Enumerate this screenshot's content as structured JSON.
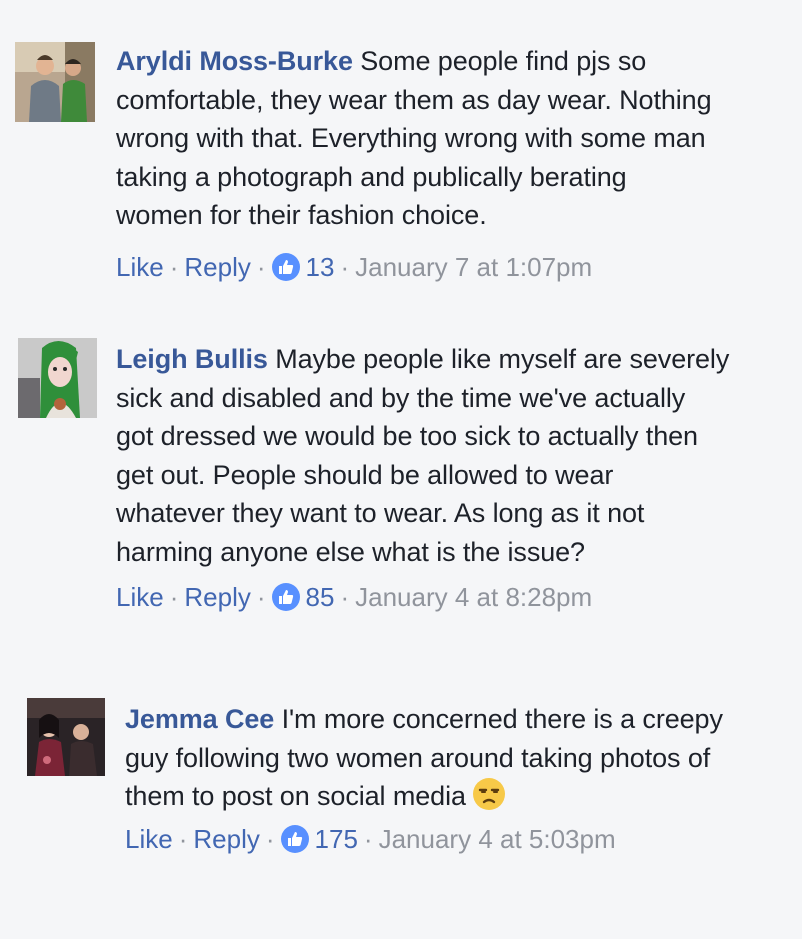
{
  "comments": [
    {
      "author": "Aryldi Moss-Burke",
      "text_lines": [
        " Some people find pjs so",
        "comfortable, they wear them as day wear. Nothing",
        "wrong with that. Everything wrong with some man",
        "taking a photograph and publically berating",
        "women for their fashion choice."
      ],
      "like_label": "Like",
      "reply_label": "Reply",
      "like_count": "13",
      "timestamp": "January 7 at 1:07pm"
    },
    {
      "author": "Leigh Bullis",
      "text_lines": [
        " Maybe people like myself are severely",
        "sick and disabled and by the time we've actually",
        "got dressed we would be too sick to actually then",
        "get out. People should be allowed to wear",
        "whatever they want to wear. As long as it not",
        "harming anyone else what is the issue?"
      ],
      "like_label": "Like",
      "reply_label": "Reply",
      "like_count": "85",
      "timestamp": "January 4 at 8:28pm"
    },
    {
      "author": "Jemma Cee",
      "text_lines": [
        " I'm more concerned there is a creepy",
        "guy following two women around taking photos of",
        "them to post on social media"
      ],
      "like_label": "Like",
      "reply_label": "Reply",
      "like_count": "175",
      "timestamp": "January 4 at 5:03pm",
      "emoji": "unamused-face-icon"
    }
  ],
  "separator": "·",
  "colors": {
    "name": "#385898",
    "link": "#4267b2",
    "meta": "#90949c",
    "like_badge": "#5890ff",
    "background": "#f5f6f8"
  }
}
